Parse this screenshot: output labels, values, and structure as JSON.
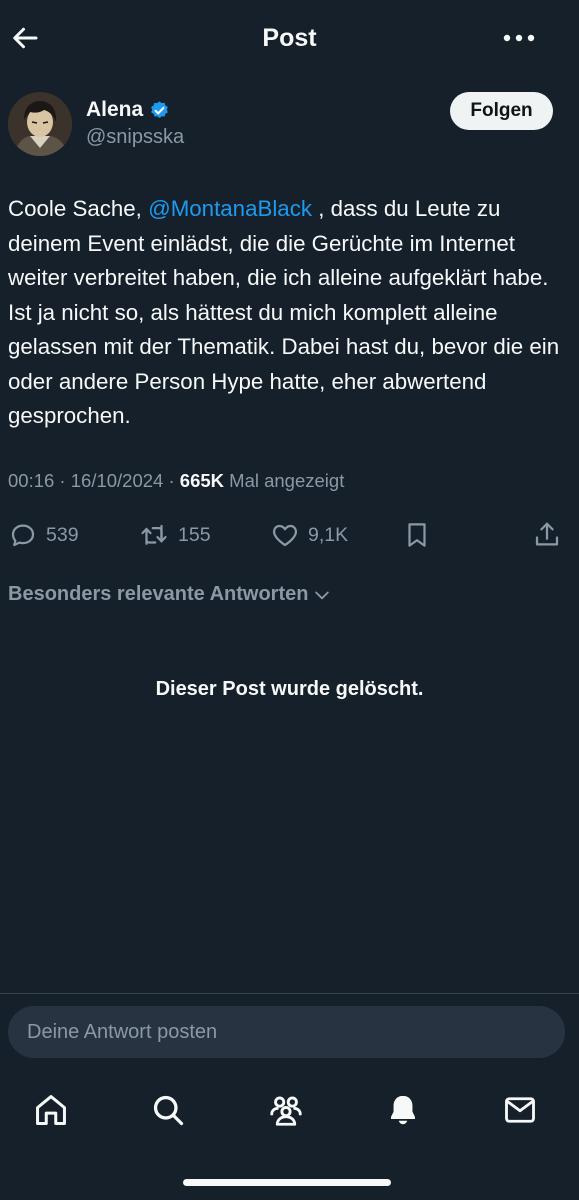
{
  "header": {
    "title": "Post",
    "back_icon": "arrow-left-icon",
    "more_icon": "more-horizontal-icon"
  },
  "author": {
    "name": "Alena",
    "handle": "@snipsska",
    "verified": true,
    "verified_color": "#1d9bf0",
    "follow_label": "Folgen"
  },
  "post": {
    "text_before": "Coole Sache, ",
    "mention": "@MontanaBlack",
    "text_after": " , dass du Leute zu deinem Event einlädst, die die Gerüchte im Internet weiter verbreitet haben, die ich alleine aufgeklärt habe. Ist ja nicht so, als hättest du mich komplett alleine gelassen mit der Thematik. Dabei hast du, bevor die ein oder andere Person Hype hatte, eher abwertend gesprochen.",
    "timestamp": "00:16 · 16/10/2024 · ",
    "views": "665K",
    "views_suffix": " Mal angezeigt"
  },
  "actions": {
    "replies": "539",
    "reposts": "155",
    "likes": "9,1K"
  },
  "replies_section": {
    "sort_label": "Besonders relevante Antworten",
    "deleted_notice": "Dieser Post wurde gelöscht."
  },
  "reply_input": {
    "placeholder": "Deine Antwort posten"
  },
  "bottom_nav": [
    "home-icon",
    "search-icon",
    "communities-icon",
    "notifications-icon",
    "messages-icon"
  ],
  "colors": {
    "background": "#15202b",
    "accent": "#1d9bf0",
    "secondary_text": "#8b98a5"
  }
}
